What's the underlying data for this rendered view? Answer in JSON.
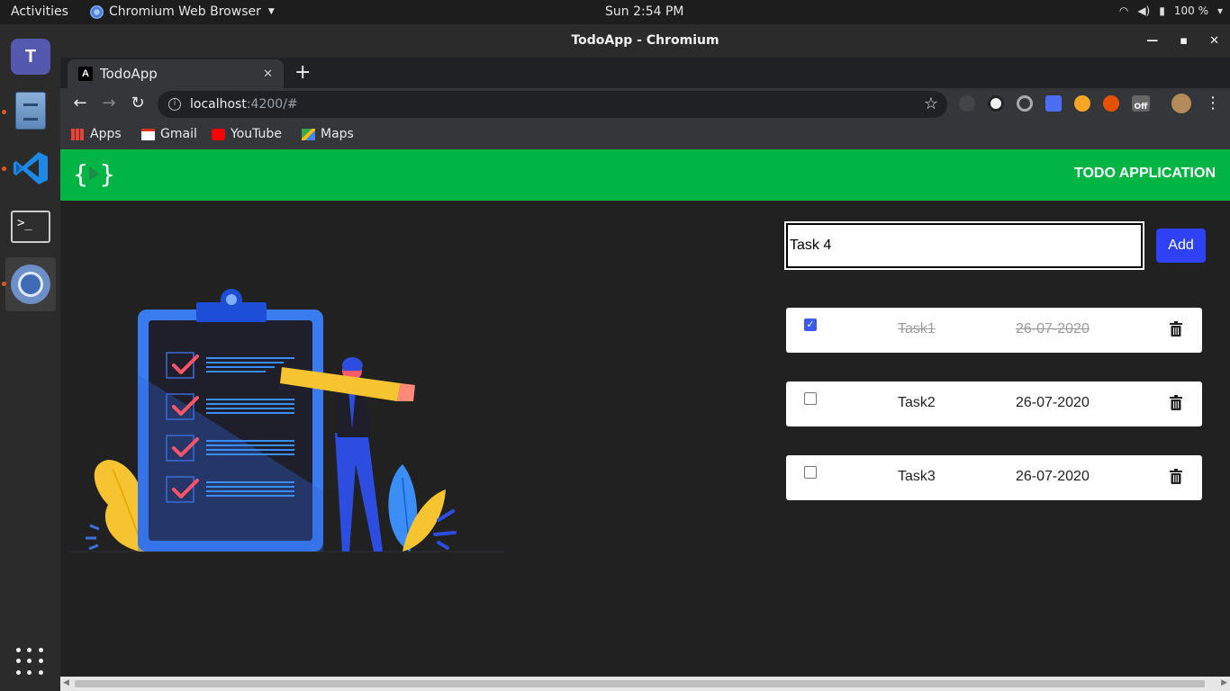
{
  "topbar": {
    "activities": "Activities",
    "app_menu": "Chromium Web Browser",
    "clock": "Sun  2:54 PM",
    "battery": "100 %"
  },
  "dock": {
    "apps": [
      "microsoft-teams",
      "files",
      "visual-studio-code",
      "terminal",
      "chromium"
    ],
    "terminal_prompt": ">_"
  },
  "window": {
    "title": "TodoApp - Chromium",
    "tab_title": "TodoApp",
    "favicon_letter": "A",
    "url_host": "localhost",
    "url_path": ":4200/#",
    "bookmarks": [
      "Apps",
      "Gmail",
      "YouTube",
      "Maps"
    ],
    "extension_badge": "Off"
  },
  "app": {
    "logo_left": "{",
    "logo_right": "}",
    "title": "TODO APPLICATION",
    "input_value": "Task 4",
    "add_label": "Add",
    "accent_color": "#00b544",
    "button_color": "#2f41f5",
    "tasks": [
      {
        "name": "Task1",
        "date": "26-07-2020",
        "completed": true
      },
      {
        "name": "Task2",
        "date": "26-07-2020",
        "completed": false
      },
      {
        "name": "Task3",
        "date": "26-07-2020",
        "completed": false
      }
    ]
  }
}
